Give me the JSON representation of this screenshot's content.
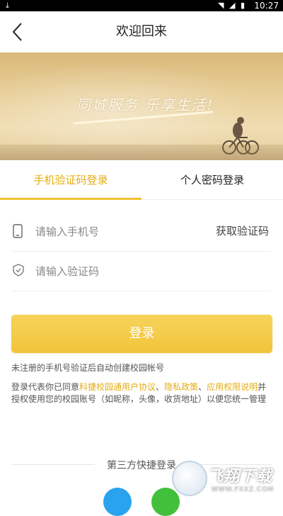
{
  "status_bar": {
    "time": "10:27",
    "icons": [
      "download-icon",
      "wifi-icon",
      "signal-icon",
      "battery-icon"
    ]
  },
  "header": {
    "title": "欢迎回来",
    "back_icon": "back-arrow-icon"
  },
  "banner": {
    "slogan": "同城服务  乐享生活!"
  },
  "tabs": [
    {
      "label": "手机验证码登录",
      "active": true
    },
    {
      "label": "个人密码登录",
      "active": false
    }
  ],
  "form": {
    "phone_placeholder": "请输入手机号",
    "phone_icon": "phone-icon",
    "get_code_label": "获取验证码",
    "code_placeholder": "请输入验证码",
    "code_icon": "shield-icon"
  },
  "login_button": "登录",
  "note": "未注册的手机号验证后自动创建校园帐号",
  "agreement": {
    "prefix": "登录代表你已同意",
    "link1": "科捷校园通用户协议",
    "sep1": "、",
    "link2": "隐私政策",
    "sep2": "、",
    "link3": "应用权限说明",
    "suffix": "并授权使用您的校园账号（如昵称，头像，收货地址）以便您统一管理"
  },
  "third_party": {
    "title": "第三方快捷登录",
    "icons": [
      "qq-icon",
      "wechat-icon"
    ]
  },
  "watermark": {
    "text": "飞翔下载",
    "url": "WWW.FXXZ.COM"
  },
  "colors": {
    "accent": "#e4ad12",
    "button": "#f2c53a",
    "qq": "#2aa3ee",
    "wechat": "#43c03b"
  }
}
